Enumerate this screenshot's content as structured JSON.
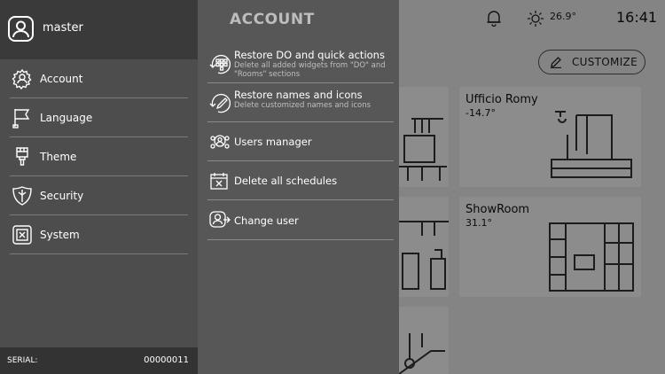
{
  "user": {
    "name": "master"
  },
  "sidebar": {
    "items": [
      {
        "label": "Account",
        "icon": "gear-user-icon"
      },
      {
        "label": "Language",
        "icon": "flag-icon"
      },
      {
        "label": "Theme",
        "icon": "brush-icon"
      },
      {
        "label": "Security",
        "icon": "shield-icon"
      },
      {
        "label": "System",
        "icon": "system-icon"
      }
    ],
    "serial_label": "SERIAL:",
    "serial_value": "00000011"
  },
  "panel": {
    "title": "ACCOUNT",
    "items": [
      {
        "title": "Restore DO and quick actions",
        "subtitle": "Delete all added widgets from \"DO\" and \"Rooms\" sections",
        "icon": "restore-grid-icon"
      },
      {
        "title": "Restore names and icons",
        "subtitle": "Delete customized names and icons",
        "icon": "restore-edit-icon"
      },
      {
        "title": "Users manager",
        "icon": "users-gear-icon"
      },
      {
        "title": "Delete all schedules",
        "icon": "calendar-delete-icon"
      },
      {
        "title": "Change user",
        "icon": "change-user-icon"
      }
    ]
  },
  "topbar": {
    "temperature": "26.9°",
    "time": "16:41"
  },
  "customize_label": "CUSTOMIZE",
  "rooms": [
    {
      "name": "Ufficio Romy",
      "value": "-14.7°"
    },
    {
      "name": "ShowRoom",
      "value": "31.1°"
    }
  ]
}
